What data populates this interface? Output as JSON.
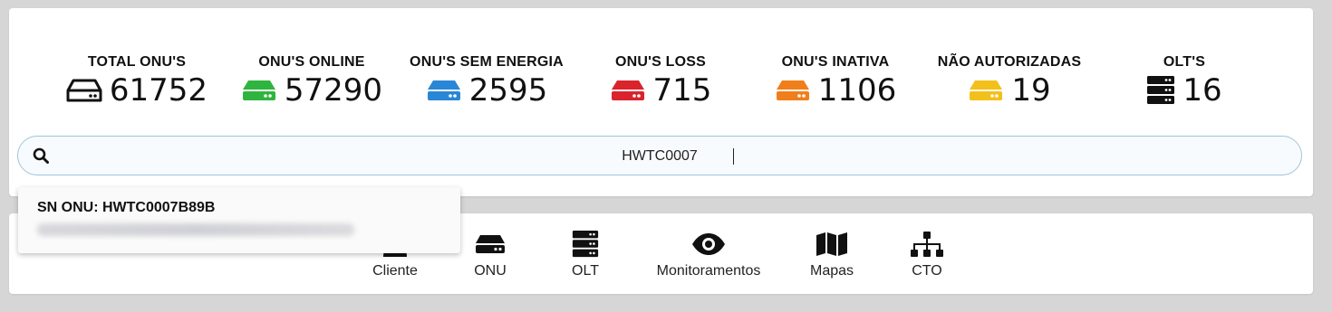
{
  "stats": [
    {
      "label": "TOTAL ONU'S",
      "value": "61752",
      "icon": "router-outline-icon",
      "color": "#111111"
    },
    {
      "label": "ONU'S ONLINE",
      "value": "57290",
      "icon": "router-icon",
      "color": "#2fb53f"
    },
    {
      "label": "ONU'S SEM ENERGIA",
      "value": "2595",
      "icon": "router-icon",
      "color": "#2a86d6"
    },
    {
      "label": "ONU'S LOSS",
      "value": "715",
      "icon": "router-icon",
      "color": "#d9232d"
    },
    {
      "label": "ONU'S INATIVA",
      "value": "1106",
      "icon": "router-icon",
      "color": "#f07f1b"
    },
    {
      "label": "NÃO AUTORIZADAS",
      "value": "19",
      "icon": "router-icon",
      "color": "#f3c01a"
    },
    {
      "label": "OLT'S",
      "value": "16",
      "icon": "server-icon",
      "color": "#111111"
    }
  ],
  "search": {
    "value": "HWTC0007",
    "icon": "search-icon"
  },
  "suggestion": {
    "title": "SN ONU: HWTC0007B89B"
  },
  "nav": [
    {
      "label": "Cliente",
      "icon": "user-icon"
    },
    {
      "label": "ONU",
      "icon": "router-icon"
    },
    {
      "label": "OLT",
      "icon": "server-icon"
    },
    {
      "label": "Monitoramentos",
      "icon": "eye-icon"
    },
    {
      "label": "Mapas",
      "icon": "map-icon"
    },
    {
      "label": "CTO",
      "icon": "sitemap-icon"
    }
  ]
}
